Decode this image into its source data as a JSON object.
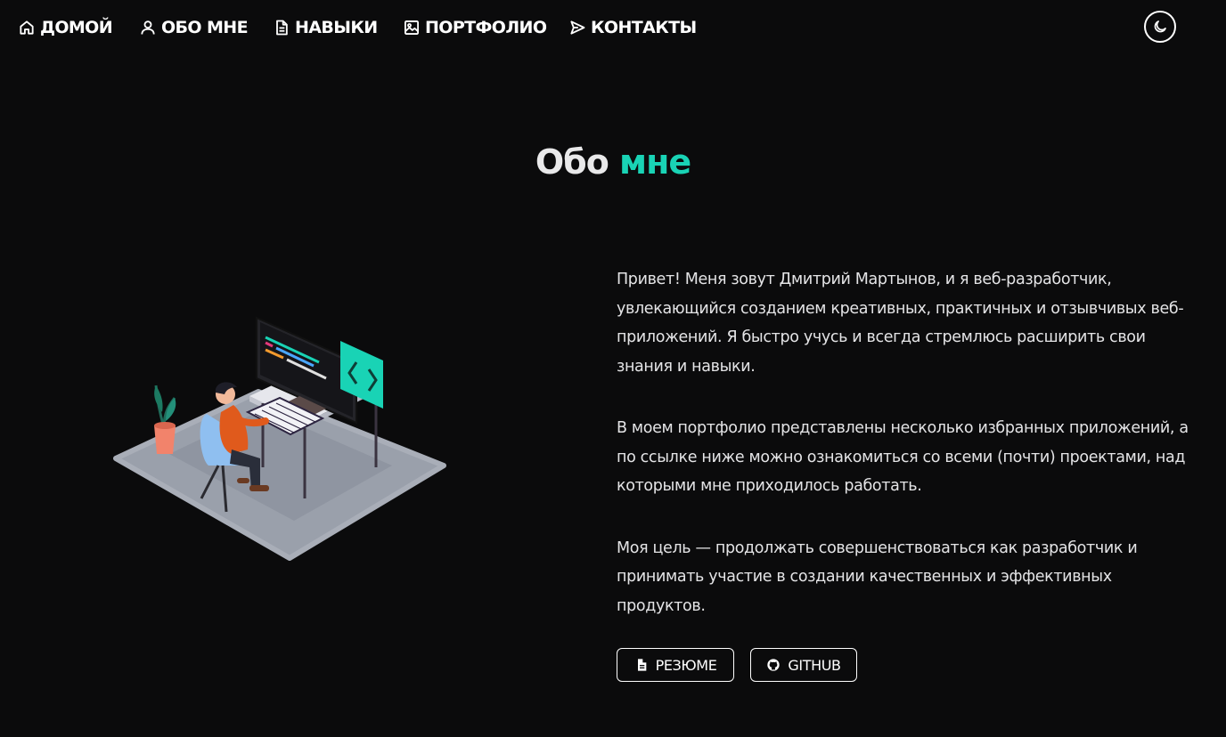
{
  "nav": {
    "items": [
      {
        "label": "ДОМОЙ",
        "icon": "home-icon"
      },
      {
        "label": "ОБО МНЕ",
        "icon": "user-icon"
      },
      {
        "label": "НАВЫКИ",
        "icon": "document-icon"
      },
      {
        "label": "ПОРТФОЛИО",
        "icon": "image-icon"
      },
      {
        "label": "КОНТАКТЫ",
        "icon": "send-icon"
      }
    ],
    "theme_toggle_icon": "moon-icon"
  },
  "section": {
    "title_main": "Обо",
    "title_accent": "мне"
  },
  "about": {
    "paragraphs": [
      "Привет! Меня зовут Дмитрий Мартынов, и я веб-разработчик, увлекающийся созданием креативных, практичных и отзывчивых веб-приложений. Я быстро учусь и всегда стремлюсь расширить свои знания и навыки.",
      "В моем портфолио представлены несколько избранных приложений, а по ссылке ниже можно ознакомиться со всеми (почти) проектами, над которыми мне приходилось работать.",
      "Моя цель — продолжать совершенствоваться как разработчик и принимать участие в создании качественных и эффективных продуктов."
    ]
  },
  "buttons": {
    "resume": {
      "label": "РЕЗЮМЕ",
      "icon": "document-icon"
    },
    "github": {
      "label": "GITHUB",
      "icon": "github-icon"
    }
  },
  "colors": {
    "background": "#0b0b0c",
    "accent": "#19d3b5",
    "text": "#e9e9ea"
  }
}
